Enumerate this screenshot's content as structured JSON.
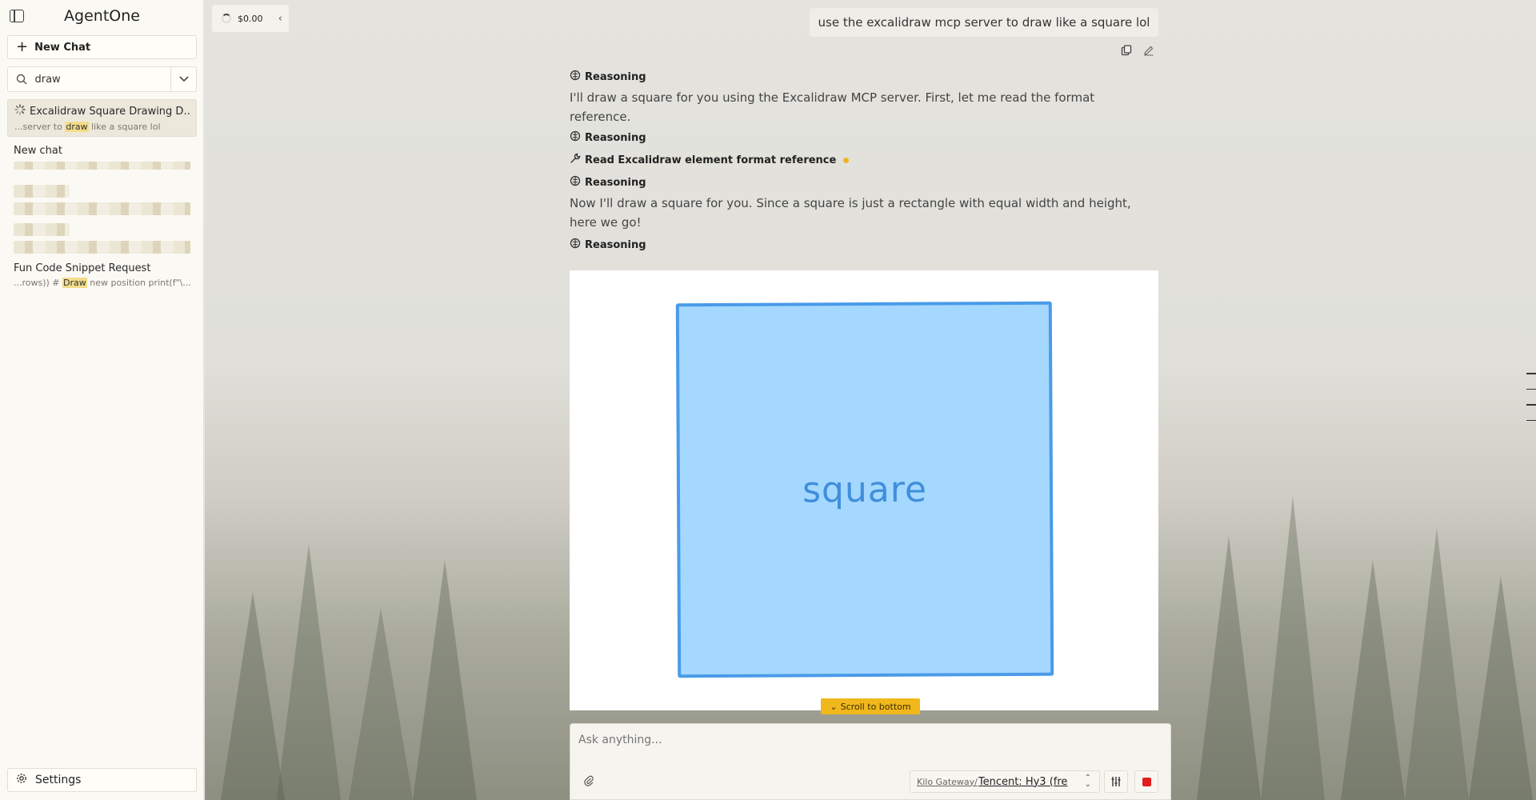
{
  "app": {
    "title": "AgentOne"
  },
  "sidebar": {
    "new_chat_label": "New Chat",
    "search": {
      "value": "draw"
    },
    "chats": [
      {
        "title": "Excalidraw Square Drawing D...",
        "snippet_pre": "...server to ",
        "snippet_match": "draw",
        "snippet_post": " like a square lol",
        "active": true,
        "loading": true
      },
      {
        "title": "New chat",
        "blurred": true
      },
      {
        "title": "",
        "blurred": true
      },
      {
        "title": "",
        "blurred": true
      },
      {
        "title": "Fun Code Snippet Request",
        "snippet_pre": "...rows)) # ",
        "snippet_match": "Draw",
        "snippet_post": " new position print(f\"\\..."
      }
    ],
    "settings_label": "Settings"
  },
  "header": {
    "cost": "$0.00"
  },
  "conversation": {
    "user_message": "use the excalidraw mcp server to draw like a square lol",
    "reasoning_label": "Reasoning",
    "para1": "I'll draw a square for you using the Excalidraw MCP server. First, let me read the format reference.",
    "tool_call": "Read Excalidraw element format reference",
    "para2": "Now I'll draw a square for you. Since a square is just a rectangle with equal width and height, here we go!",
    "canvas": {
      "shape_label": "square",
      "fill_color": "#a5d8ff",
      "stroke_color": "#4a9be8"
    },
    "scroll_to_bottom_label": "Scroll to bottom"
  },
  "composer": {
    "placeholder": "Ask anything...",
    "model_provider": "Kilo Gateway/",
    "model_name": "Tencent: Hy3 (fre"
  },
  "colors": {
    "accent": "#f0b81c",
    "stop": "#e11d1d"
  }
}
